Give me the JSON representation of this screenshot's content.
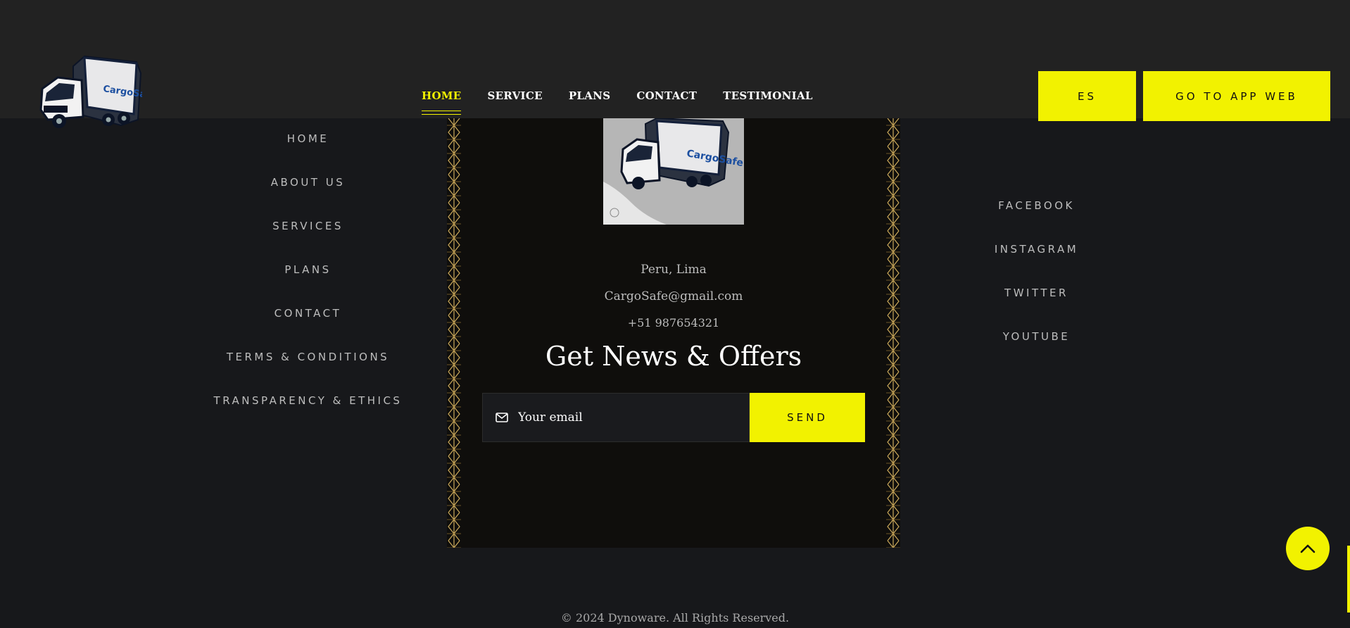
{
  "header": {
    "nav": [
      "HOME",
      "SERVICE",
      "PLANS",
      "CONTACT",
      "TESTIMONIAL"
    ],
    "active_nav": "HOME",
    "lang_button": "ES",
    "app_button": "GO TO APP WEB",
    "logo_text": "CargoSafe"
  },
  "footer": {
    "left_links": [
      "HOME",
      "ABOUT US",
      "SERVICES",
      "PLANS",
      "CONTACT",
      "TERMS & CONDITIONS",
      "TRANSPARENCY & ETHICS"
    ],
    "right_links": [
      "FACEBOOK",
      "INSTAGRAM",
      "TWITTER",
      "YOUTUBE"
    ],
    "center": {
      "location": "Peru, Lima",
      "email": "CargoSafe@gmail.com",
      "phone": "+51 987654321",
      "newsletter_title": "Get News & Offers",
      "email_placeholder": "Your email",
      "send_label": "SEND"
    },
    "copyright": "© 2024 Dynoware. All Rights Reserved."
  },
  "colors": {
    "accent": "#f2f200",
    "background": "#17181b",
    "header": "#222222",
    "panel": "#0f0e0c"
  },
  "icons": {
    "email": "mail-icon",
    "scroll_top": "chevron-up-icon"
  }
}
